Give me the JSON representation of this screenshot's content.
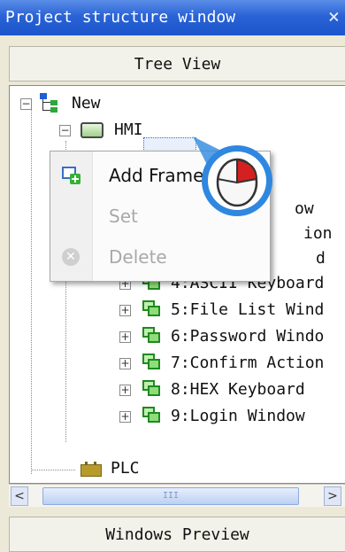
{
  "window": {
    "title": "Project structure window",
    "close_glyph": "×"
  },
  "header": {
    "label": "Tree View"
  },
  "tree": {
    "root": {
      "label": "New",
      "expander": "−",
      "icon": "project-tree-icon"
    },
    "hmi": {
      "label": "HMI",
      "expander": "−",
      "icon": "hmi-screen-icon"
    },
    "windows": [
      {
        "label": "ow",
        "expander": "+"
      },
      {
        "label": "ion",
        "expander": "+"
      },
      {
        "label": "d",
        "expander": "+"
      },
      {
        "label": "4:ASCII Keyboard",
        "expander": "+"
      },
      {
        "label": "5:File List Wind",
        "expander": "+"
      },
      {
        "label": "6:Password Windo",
        "expander": "+"
      },
      {
        "label": "7:Confirm Action",
        "expander": "+"
      },
      {
        "label": "8:HEX Keyboard",
        "expander": "+"
      },
      {
        "label": "9:Login Window",
        "expander": "+"
      }
    ],
    "plc": {
      "label": "PLC",
      "icon": "plc-icon"
    }
  },
  "context_menu": {
    "items": [
      {
        "label": "Add Frame",
        "enabled": true,
        "icon": "add-frame-icon"
      },
      {
        "label": "Set",
        "enabled": false,
        "icon": ""
      },
      {
        "label": "Delete",
        "enabled": false,
        "icon": "delete-icon"
      }
    ]
  },
  "scrollbar": {
    "left_arrow": "<",
    "right_arrow": ">",
    "thumb_grip": "III"
  },
  "footer": {
    "label": "Windows Preview"
  },
  "colors": {
    "titlebar": "#2a63d6",
    "window_icon_green": "#1f8a1f",
    "mouse_accent": "#d42020"
  }
}
